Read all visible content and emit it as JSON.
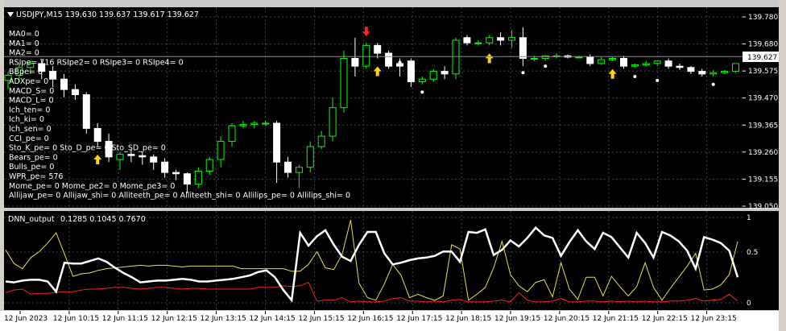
{
  "symbol_line": "USDJPY,M15  139.630 139.637 139.617 139.627",
  "main_indicators": [
    "MA0= 0",
    "MA1= 0",
    "MA2= 0",
    "RSIpe= 716  RSIpe2= 0  RSIpe3= 0  RSIpe4= 0",
    "BBpe= 0",
    "ADXpe= 0",
    "MACD_S= 0",
    "MACD_L= 0",
    "Ich_ten= 0",
    "Ich_ki= 0",
    "Ich_sen= 0",
    "CCI_pe= 0",
    "Sto_K_pe= 0  Sto_D_pe= 0  Sto_SD_pe= 0",
    "Bears_pe= 0",
    "Bulls_pe= 0",
    "WPR_pe= 576",
    "Mome_pe= 0  Mome_pe2= 0  Mome_pe3= 0",
    "Allijaw_pe= 0  Allijaw_shi= 0  Alliteeth_pe= 0  Alliteeth_shi= 0  Allilips_pe= 0  Allilips_shi= 0"
  ],
  "price_axis": [
    "139.780",
    "139.680",
    "139.575",
    "139.470",
    "139.365",
    "139.260",
    "139.155",
    "139.050"
  ],
  "current_price": "139.627",
  "sub_window": {
    "title": "DNN_output",
    "values": "0.1285 0.1045 0.7670",
    "axis": [
      "1",
      "0.5",
      "0"
    ]
  },
  "time_axis": [
    "12 Jun 2023",
    "12 Jun 10:15",
    "12 Jun 11:15",
    "12 Jun 12:15",
    "12 Jun 13:15",
    "12 Jun 14:15",
    "12 Jun 15:15",
    "12 Jun 16:15",
    "12 Jun 17:15",
    "12 Jun 18:15",
    "12 Jun 19:15",
    "12 Jun 20:15",
    "12 Jun 21:15",
    "12 Jun 22:15",
    "12 Jun 23:15"
  ],
  "colors": {
    "background": "#000000",
    "bull_candle": "#00ff00",
    "bear_candle": "#ffffff",
    "grid": "#3c4450",
    "arrow_up": "#ffd700",
    "arrow_down": "#ff2020",
    "series_white": "#ffffff",
    "series_yellow": "#e8e04a",
    "series_red": "#ff2020"
  },
  "chart_data": {
    "type": "candlestick",
    "y_range": [
      139.03,
      139.82
    ],
    "candles": [
      {
        "o": 139.535,
        "h": 139.57,
        "c": 139.555,
        "l": 139.5
      },
      {
        "o": 139.555,
        "h": 139.6,
        "c": 139.585,
        "l": 139.53
      },
      {
        "o": 139.585,
        "h": 139.61,
        "c": 139.6,
        "l": 139.56
      },
      {
        "o": 139.6,
        "h": 139.615,
        "c": 139.57,
        "l": 139.54
      },
      {
        "o": 139.57,
        "h": 139.59,
        "c": 139.54,
        "l": 139.51
      },
      {
        "o": 139.54,
        "h": 139.56,
        "c": 139.5,
        "l": 139.47
      },
      {
        "o": 139.5,
        "h": 139.52,
        "c": 139.48,
        "l": 139.46
      },
      {
        "o": 139.48,
        "h": 139.49,
        "c": 139.35,
        "l": 139.33
      },
      {
        "o": 139.35,
        "h": 139.37,
        "c": 139.3,
        "l": 139.28
      },
      {
        "o": 139.3,
        "h": 139.33,
        "c": 139.24,
        "l": 139.22
      },
      {
        "o": 139.23,
        "h": 139.26,
        "c": 139.25,
        "l": 139.19
      },
      {
        "o": 139.25,
        "h": 139.27,
        "c": 139.245,
        "l": 139.22
      },
      {
        "o": 139.245,
        "h": 139.26,
        "c": 139.24,
        "l": 139.21
      },
      {
        "o": 139.24,
        "h": 139.25,
        "c": 139.22,
        "l": 139.19
      },
      {
        "o": 139.22,
        "h": 139.235,
        "c": 139.18,
        "l": 139.16
      },
      {
        "o": 139.18,
        "h": 139.19,
        "c": 139.175,
        "l": 139.15
      },
      {
        "o": 139.175,
        "h": 139.18,
        "c": 139.135,
        "l": 139.1
      },
      {
        "o": 139.135,
        "h": 139.2,
        "c": 139.185,
        "l": 139.12
      },
      {
        "o": 139.185,
        "h": 139.24,
        "c": 139.23,
        "l": 139.17
      },
      {
        "o": 139.23,
        "h": 139.32,
        "c": 139.3,
        "l": 139.2
      },
      {
        "o": 139.3,
        "h": 139.37,
        "c": 139.36,
        "l": 139.28
      },
      {
        "o": 139.36,
        "h": 139.38,
        "c": 139.365,
        "l": 139.35
      },
      {
        "o": 139.365,
        "h": 139.38,
        "c": 139.37,
        "l": 139.35
      },
      {
        "o": 139.37,
        "h": 139.38,
        "c": 139.37,
        "l": 139.36
      },
      {
        "o": 139.37,
        "h": 139.38,
        "c": 139.22,
        "l": 139.14
      },
      {
        "o": 139.22,
        "h": 139.24,
        "c": 139.18,
        "l": 139.16
      },
      {
        "o": 139.18,
        "h": 139.21,
        "c": 139.2,
        "l": 139.12
      },
      {
        "o": 139.2,
        "h": 139.3,
        "c": 139.28,
        "l": 139.18
      },
      {
        "o": 139.28,
        "h": 139.34,
        "c": 139.32,
        "l": 139.27
      },
      {
        "o": 139.32,
        "h": 139.47,
        "c": 139.43,
        "l": 139.3
      },
      {
        "o": 139.43,
        "h": 139.65,
        "c": 139.62,
        "l": 139.41
      },
      {
        "o": 139.62,
        "h": 139.7,
        "c": 139.59,
        "l": 139.55
      },
      {
        "o": 139.59,
        "h": 139.68,
        "c": 139.67,
        "l": 139.58
      },
      {
        "o": 139.67,
        "h": 139.68,
        "c": 139.64,
        "l": 139.62
      },
      {
        "o": 139.64,
        "h": 139.65,
        "c": 139.59,
        "l": 139.58
      },
      {
        "o": 139.6,
        "h": 139.62,
        "c": 139.59,
        "l": 139.55
      },
      {
        "o": 139.61,
        "h": 139.62,
        "c": 139.53,
        "l": 139.51
      },
      {
        "o": 139.53,
        "h": 139.55,
        "c": 139.54,
        "l": 139.52
      },
      {
        "o": 139.54,
        "h": 139.58,
        "c": 139.57,
        "l": 139.53
      },
      {
        "o": 139.57,
        "h": 139.59,
        "c": 139.56,
        "l": 139.54
      },
      {
        "o": 139.56,
        "h": 139.7,
        "c": 139.69,
        "l": 139.54
      },
      {
        "o": 139.7,
        "h": 139.71,
        "c": 139.68,
        "l": 139.67
      },
      {
        "o": 139.68,
        "h": 139.69,
        "c": 139.68,
        "l": 139.67
      },
      {
        "o": 139.68,
        "h": 139.71,
        "c": 139.7,
        "l": 139.67
      },
      {
        "o": 139.7,
        "h": 139.72,
        "c": 139.69,
        "l": 139.67
      },
      {
        "o": 139.69,
        "h": 139.73,
        "c": 139.7,
        "l": 139.66
      },
      {
        "o": 139.7,
        "h": 139.74,
        "c": 139.62,
        "l": 139.59
      },
      {
        "o": 139.62,
        "h": 139.63,
        "c": 139.62,
        "l": 139.61
      },
      {
        "o": 139.62,
        "h": 139.63,
        "c": 139.63,
        "l": 139.61
      },
      {
        "o": 139.63,
        "h": 139.64,
        "c": 139.63,
        "l": 139.62
      },
      {
        "o": 139.63,
        "h": 139.635,
        "c": 139.625,
        "l": 139.62
      },
      {
        "o": 139.625,
        "h": 139.63,
        "c": 139.625,
        "l": 139.62
      },
      {
        "o": 139.625,
        "h": 139.635,
        "c": 139.6,
        "l": 139.59
      },
      {
        "o": 139.6,
        "h": 139.625,
        "c": 139.615,
        "l": 139.595
      },
      {
        "o": 139.615,
        "h": 139.625,
        "c": 139.62,
        "l": 139.61
      },
      {
        "o": 139.62,
        "h": 139.63,
        "c": 139.59,
        "l": 139.58
      },
      {
        "o": 139.59,
        "h": 139.6,
        "c": 139.595,
        "l": 139.585
      },
      {
        "o": 139.595,
        "h": 139.61,
        "c": 139.6,
        "l": 139.59
      },
      {
        "o": 139.6,
        "h": 139.61,
        "c": 139.61,
        "l": 139.59
      },
      {
        "o": 139.61,
        "h": 139.62,
        "c": 139.59,
        "l": 139.58
      },
      {
        "o": 139.59,
        "h": 139.6,
        "c": 139.585,
        "l": 139.575
      },
      {
        "o": 139.585,
        "h": 139.59,
        "c": 139.57,
        "l": 139.56
      },
      {
        "o": 139.57,
        "h": 139.58,
        "c": 139.56,
        "l": 139.55
      },
      {
        "o": 139.56,
        "h": 139.575,
        "c": 139.565,
        "l": 139.55
      },
      {
        "o": 139.565,
        "h": 139.575,
        "c": 139.57,
        "l": 139.56
      },
      {
        "o": 139.57,
        "h": 139.6,
        "c": 139.6,
        "l": 139.565
      }
    ],
    "arrows_up": [
      8,
      33,
      43,
      54
    ],
    "arrows_down": [
      32
    ],
    "dots": [
      {
        "i": 35,
        "p": 139.605
      },
      {
        "i": 37,
        "p": 139.49
      },
      {
        "i": 46,
        "p": 139.565
      },
      {
        "i": 48,
        "p": 139.59
      },
      {
        "i": 56,
        "p": 139.55
      },
      {
        "i": 58,
        "p": 139.535
      },
      {
        "i": 63,
        "p": 139.52
      }
    ],
    "dnn_series": [
      {
        "color": "white",
        "values": [
          0.25,
          0.24,
          0.26,
          0.27,
          0.27,
          0.25,
          0.13,
          0.47,
          0.46,
          0.46,
          0.49,
          0.52,
          0.48,
          0.41,
          0.35,
          0.3,
          0.24,
          0.25,
          0.26,
          0.26,
          0.27,
          0.28,
          0.27,
          0.25,
          0.25,
          0.26,
          0.27,
          0.28,
          0.3,
          0.32,
          0.36,
          0.38,
          0.3,
          0.15,
          0.03,
          0.82,
          0.67,
          0.78,
          0.85,
          0.68,
          0.54,
          0.49,
          0.68,
          0.83,
          0.83,
          0.58,
          0.45,
          0.47,
          0.5,
          0.52,
          0.53,
          0.55,
          0.6,
          0.6,
          0.48,
          0.83,
          0.82,
          0.86,
          0.56,
          0.62,
          0.73,
          0.66,
          0.76,
          0.88,
          0.79,
          0.76,
          0.55,
          0.71,
          0.85,
          0.72,
          0.63,
          0.82,
          0.77,
          0.65,
          0.53,
          0.82,
          0.7,
          0.53,
          0.83,
          0.79,
          0.72,
          0.61,
          0.4,
          0.77,
          0.74,
          0.7,
          0.61,
          0.3
        ]
      },
      {
        "color": "yellow",
        "values": [
          0.62,
          0.46,
          0.4,
          0.53,
          0.6,
          0.7,
          0.82,
          0.57,
          0.31,
          0.34,
          0.35,
          0.38,
          0.4,
          0.41,
          0.42,
          0.43,
          0.44,
          0.43,
          0.44,
          0.44,
          0.43,
          0.42,
          0.43,
          0.43,
          0.43,
          0.43,
          0.43,
          0.43,
          0.4,
          0.4,
          0.4,
          0.4,
          0.4,
          0.4,
          0.37,
          0.37,
          0.45,
          0.6,
          0.41,
          0.39,
          0.57,
          0.97,
          0.23,
          0.06,
          0.03,
          0.22,
          0.45,
          0.32,
          0.06,
          0.1,
          0.06,
          0.03,
          0.08,
          0.68,
          0.63,
          0.03,
          0.1,
          0.18,
          0.41,
          0.72,
          0.33,
          0.2,
          0.13,
          0.24,
          0.27,
          0.07,
          0.47,
          0.16,
          0.04,
          0.3,
          0.3,
          0.08,
          0.31,
          0.19,
          0.08,
          0.19,
          0.47,
          0.18,
          0.03,
          0.17,
          0.3,
          0.43,
          0.58,
          0.15,
          0.16,
          0.21,
          0.33,
          0.72
        ]
      },
      {
        "color": "red",
        "values": [
          0.12,
          0.15,
          0.16,
          0.1,
          0.11,
          0.11,
          0.12,
          0.13,
          0.13,
          0.15,
          0.16,
          0.16,
          0.17,
          0.18,
          0.18,
          0.17,
          0.16,
          0.17,
          0.18,
          0.18,
          0.17,
          0.16,
          0.17,
          0.17,
          0.16,
          0.16,
          0.16,
          0.16,
          0.16,
          0.16,
          0.18,
          0.18,
          0.18,
          0.2,
          0.19,
          0.2,
          0.24,
          0.02,
          0.03,
          0.03,
          0.06,
          0.01,
          0.02,
          0.01,
          0.01,
          0.02,
          0.05,
          0.06,
          0.02,
          0.02,
          0.01,
          0.02,
          0.01,
          0.03,
          0.04,
          0.01,
          0.01,
          0.01,
          0.02,
          0.03,
          0.01,
          0.12,
          0.03,
          0.01,
          0.01,
          0.02,
          0.05,
          0.01,
          0.01,
          0.02,
          0.02,
          0.01,
          0.02,
          0.01,
          0.02,
          0.01,
          0.02,
          0.01,
          0.01,
          0.02,
          0.02,
          0.03,
          0.05,
          0.02,
          0.03,
          0.04,
          0.1,
          0.02
        ]
      }
    ]
  }
}
